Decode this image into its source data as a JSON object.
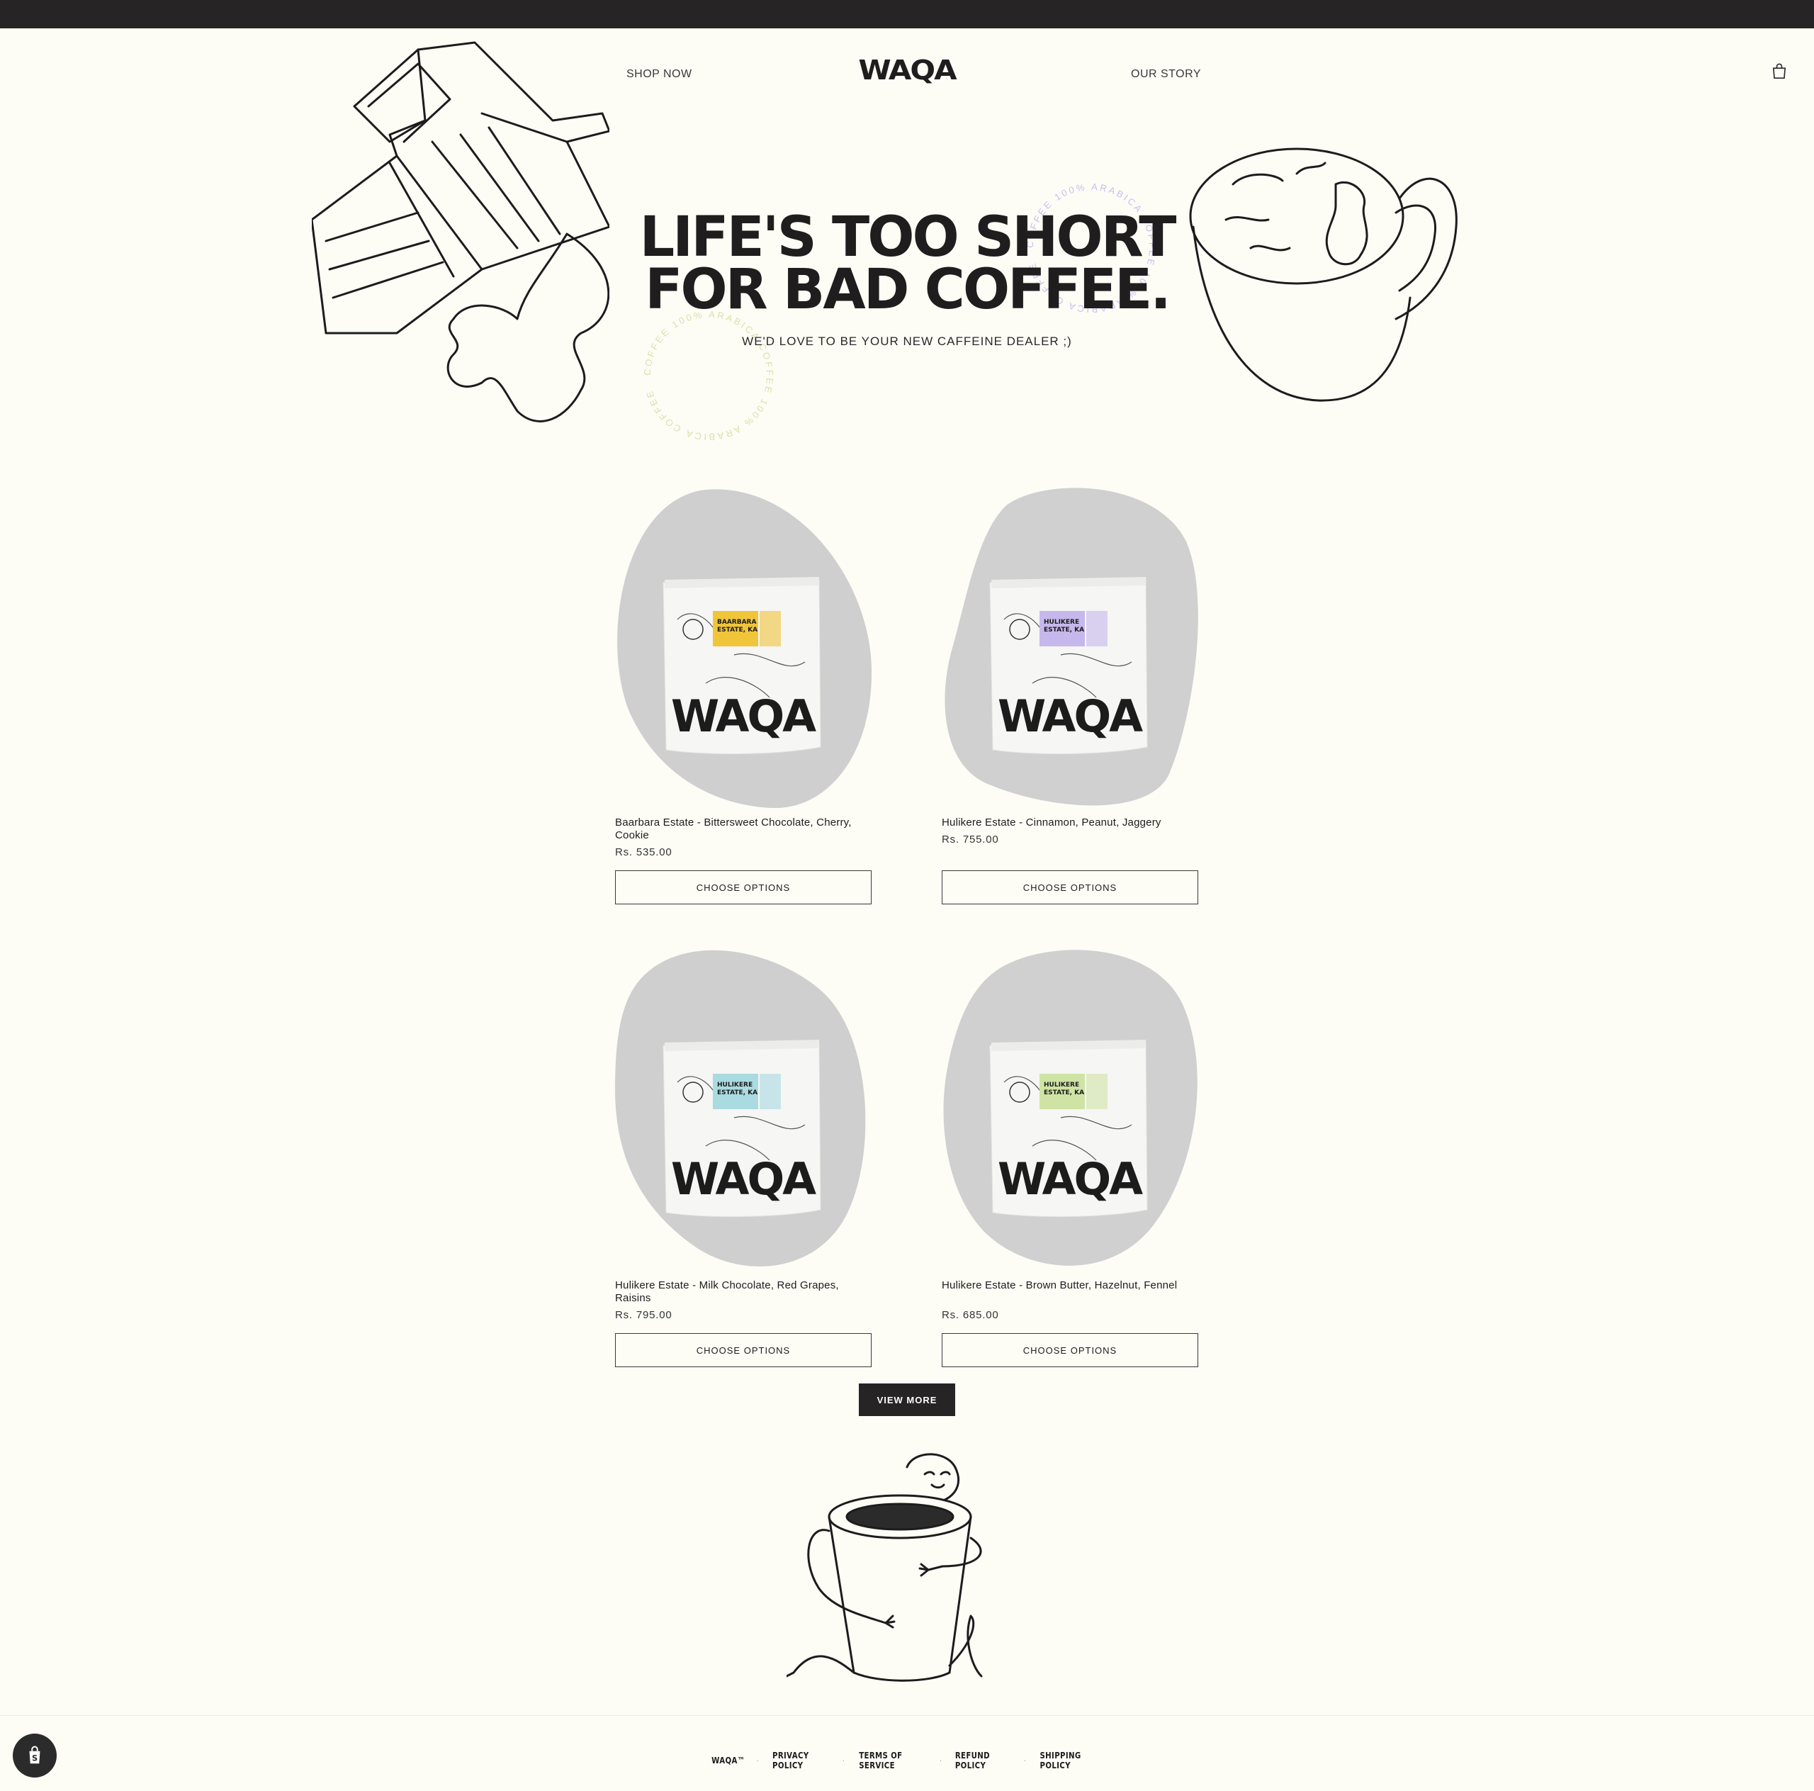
{
  "brand": "WAQA",
  "nav": {
    "shop_now": "SHOP NOW",
    "our_story": "OUR STORY"
  },
  "hero": {
    "title_line1": "LIFE'S TOO SHORT",
    "title_line2": "FOR BAD COFFEE.",
    "subtitle": "WE'D LOVE TO BE YOUR NEW CAFFEINE DEALER ;)",
    "circle_text": "COFFEE 100% ARABICA COFFEE 100% ARABICA COFFEE "
  },
  "products": [
    {
      "name": "Baarbara Estate - Bittersweet Chocolate, Cherry, Cookie",
      "price": "Rs. 535.00",
      "button": "CHOOSE OPTIONS",
      "label_lines": [
        "BAARBARA",
        "ESTATE, KA"
      ],
      "label_color": "#f0c53a",
      "blob_color": "#cfcfd0"
    },
    {
      "name": "Hulikere Estate - Cinnamon, Peanut, Jaggery",
      "price": "Rs. 755.00",
      "button": "CHOOSE OPTIONS",
      "label_lines": [
        "HULIKERE",
        "ESTATE, KA"
      ],
      "label_color": "#c6b8ec",
      "blob_color": "#d0d0d1"
    },
    {
      "name": "Hulikere Estate - Milk Chocolate, Red Grapes, Raisins",
      "price": "Rs. 795.00",
      "button": "CHOOSE OPTIONS",
      "label_lines": [
        "HULIKERE",
        "ESTATE, KA"
      ],
      "label_color": "#a9dbe0",
      "blob_color": "#cfcfd0"
    },
    {
      "name": "Hulikere Estate - Brown Butter, Hazelnut, Fennel",
      "price": "Rs. 685.00",
      "button": "CHOOSE OPTIONS",
      "label_lines": [
        "HULIKERE",
        "ESTATE, KA"
      ],
      "label_color": "#cfe4a4",
      "blob_color": "#d0d0d1"
    }
  ],
  "view_more": "VIEW MORE",
  "footer": {
    "links": [
      "WAQA™",
      "PRIVACY POLICY",
      "TERMS OF SERVICE",
      "REFUND POLICY",
      "SHIPPING POLICY"
    ]
  },
  "colors": {
    "background": "#fdfdf6",
    "dark": "#262424",
    "circle_green": "#d8e2a8",
    "circle_purple": "#c8bdf0"
  },
  "icons": {
    "cart": "cart-icon",
    "shopify": "shopify-bag-icon"
  }
}
